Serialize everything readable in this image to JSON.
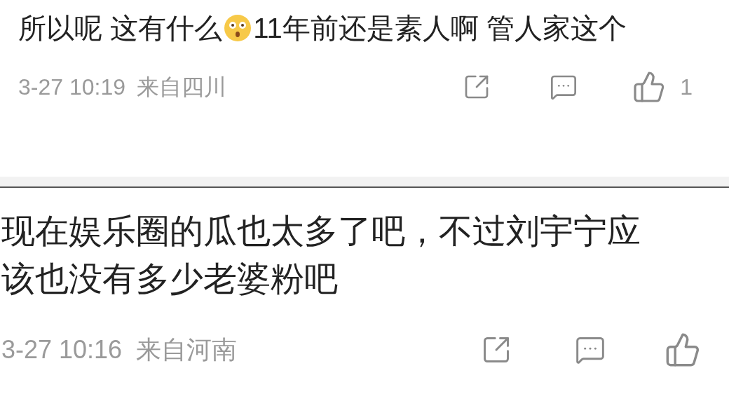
{
  "comments": [
    {
      "text_before_emoji": "所以呢 这有什么",
      "emoji": true,
      "text_after_emoji": "11年前还是素人啊 管人家这个",
      "time": "3-27 10:19",
      "location": "来自四川",
      "like_count": "1"
    },
    {
      "text": "现在娱乐圈的瓜也太多了吧，不过刘宇宁应该也没有多少老婆粉吧",
      "time": "3-27 10:16",
      "location": "来自河南"
    }
  ]
}
